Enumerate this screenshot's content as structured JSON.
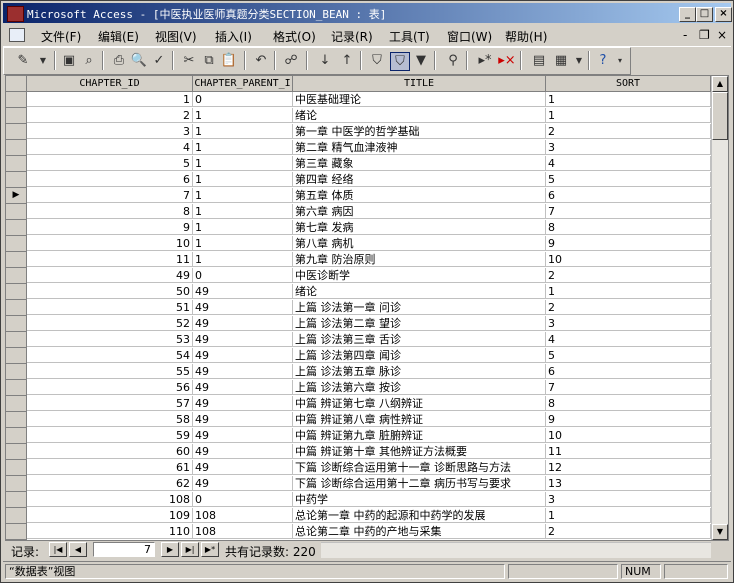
{
  "window": {
    "title": "Microsoft Access - [中医执业医师真题分类SECTION_BEAN : 表]"
  },
  "menu": [
    "文件(F)",
    "编辑(E)",
    "视图(V)",
    "插入(I)",
    "格式(O)",
    "记录(R)",
    "工具(T)",
    "窗口(W)",
    "帮助(H)"
  ],
  "columns": [
    "CHAPTER_ID",
    "CHAPTER_PARENT_I",
    "TITLE",
    "SORT"
  ],
  "rows": [
    [
      "1",
      "0",
      "中医基础理论",
      "1"
    ],
    [
      "2",
      "1",
      "绪论",
      "1"
    ],
    [
      "3",
      "1",
      "第一章 中医学的哲学基础",
      "2"
    ],
    [
      "4",
      "1",
      "第二章 精气血津液神",
      "3"
    ],
    [
      "5",
      "1",
      "第三章 藏象",
      "4"
    ],
    [
      "6",
      "1",
      "第四章 经络",
      "5"
    ],
    [
      "7",
      "1",
      "第五章 体质",
      "6"
    ],
    [
      "8",
      "1",
      "第六章 病因",
      "7"
    ],
    [
      "9",
      "1",
      "第七章 发病",
      "8"
    ],
    [
      "10",
      "1",
      "第八章 病机",
      "9"
    ],
    [
      "11",
      "1",
      "第九章 防治原则",
      "10"
    ],
    [
      "49",
      "0",
      "中医诊断学",
      "2"
    ],
    [
      "50",
      "49",
      "绪论",
      "1"
    ],
    [
      "51",
      "49",
      "上篇 诊法第一章 问诊",
      "2"
    ],
    [
      "52",
      "49",
      "上篇 诊法第二章 望诊",
      "3"
    ],
    [
      "53",
      "49",
      "上篇 诊法第三章 舌诊",
      "4"
    ],
    [
      "54",
      "49",
      "上篇 诊法第四章 闻诊",
      "5"
    ],
    [
      "55",
      "49",
      "上篇 诊法第五章 脉诊",
      "6"
    ],
    [
      "56",
      "49",
      "上篇 诊法第六章 按诊",
      "7"
    ],
    [
      "57",
      "49",
      "中篇 辨证第七章 八纲辨证",
      "8"
    ],
    [
      "58",
      "49",
      "中篇 辨证第八章 病性辨证",
      "9"
    ],
    [
      "59",
      "49",
      "中篇 辨证第九章 脏腑辨证",
      "10"
    ],
    [
      "60",
      "49",
      "中篇 辨证第十章 其他辨证方法概要",
      "11"
    ],
    [
      "61",
      "49",
      "下篇 诊断综合运用第十一章 诊断思路与方法",
      "12"
    ],
    [
      "62",
      "49",
      "下篇 诊断综合运用第十二章 病历书写与要求",
      "13"
    ],
    [
      "108",
      "0",
      "中药学",
      "3"
    ],
    [
      "109",
      "108",
      "总论第一章 中药的起源和中药学的发展",
      "1"
    ],
    [
      "110",
      "108",
      "总论第二章 中药的产地与采集",
      "2"
    ]
  ],
  "current_row_index": 6,
  "nav": {
    "label": "记录:",
    "current": "7",
    "total_label": "共有记录数: 220"
  },
  "status": {
    "view": "“数据表”视图",
    "num": "NUM"
  }
}
